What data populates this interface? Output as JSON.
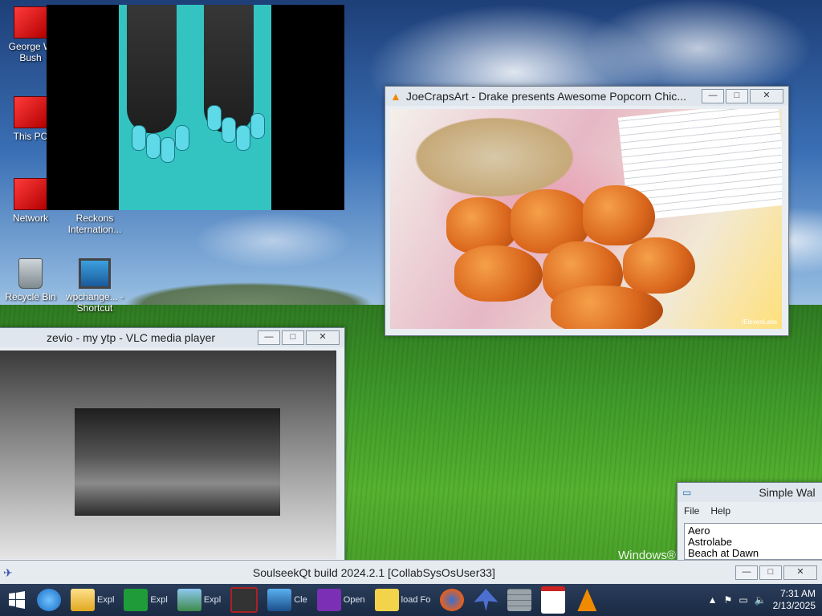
{
  "desktop": {
    "icons": [
      {
        "label": "George W Bush"
      },
      {
        "label": "This PC"
      },
      {
        "label": "Network"
      },
      {
        "label": "Reckons Internation..."
      },
      {
        "label": "Recycle Bin"
      },
      {
        "label": "wpchange... - Shortcut"
      }
    ],
    "brand": "Windows®"
  },
  "windows": {
    "food": {
      "title": "JoeCrapsArt - Drake presents Awesome Popcorn Chic...",
      "watermark": "/ElevenLabs"
    },
    "vlc": {
      "title": "zevio - my ytp - VLC media player"
    },
    "wallpaper": {
      "title": "Simple Wal",
      "menu": [
        "File",
        "Help"
      ],
      "items": [
        "Aero",
        "Astrolabe",
        "Beach at Dawn"
      ]
    },
    "soulseek": {
      "title": "SoulseekQt build 2024.2.1 [CollabSysOsUser33]"
    }
  },
  "controls": {
    "minimize": "—",
    "maximize": "□",
    "close": "✕"
  },
  "taskbar": {
    "items": [
      {
        "name": "ie",
        "label": ""
      },
      {
        "name": "explorer",
        "label": "Expl"
      },
      {
        "name": "store",
        "label": "Expl"
      },
      {
        "name": "landscape",
        "label": "Expl"
      },
      {
        "name": "media",
        "label": ""
      },
      {
        "name": "cleanup",
        "label": "Cle"
      },
      {
        "name": "magnifier",
        "label": "Open"
      },
      {
        "name": "help",
        "label": "load Fo"
      },
      {
        "name": "firefox",
        "label": ""
      },
      {
        "name": "bird",
        "label": ""
      },
      {
        "name": "wall",
        "label": ""
      },
      {
        "name": "calendar",
        "label": ""
      },
      {
        "name": "vlc",
        "label": ""
      }
    ],
    "time": "7:31 AM",
    "date": "2/13/2025"
  }
}
